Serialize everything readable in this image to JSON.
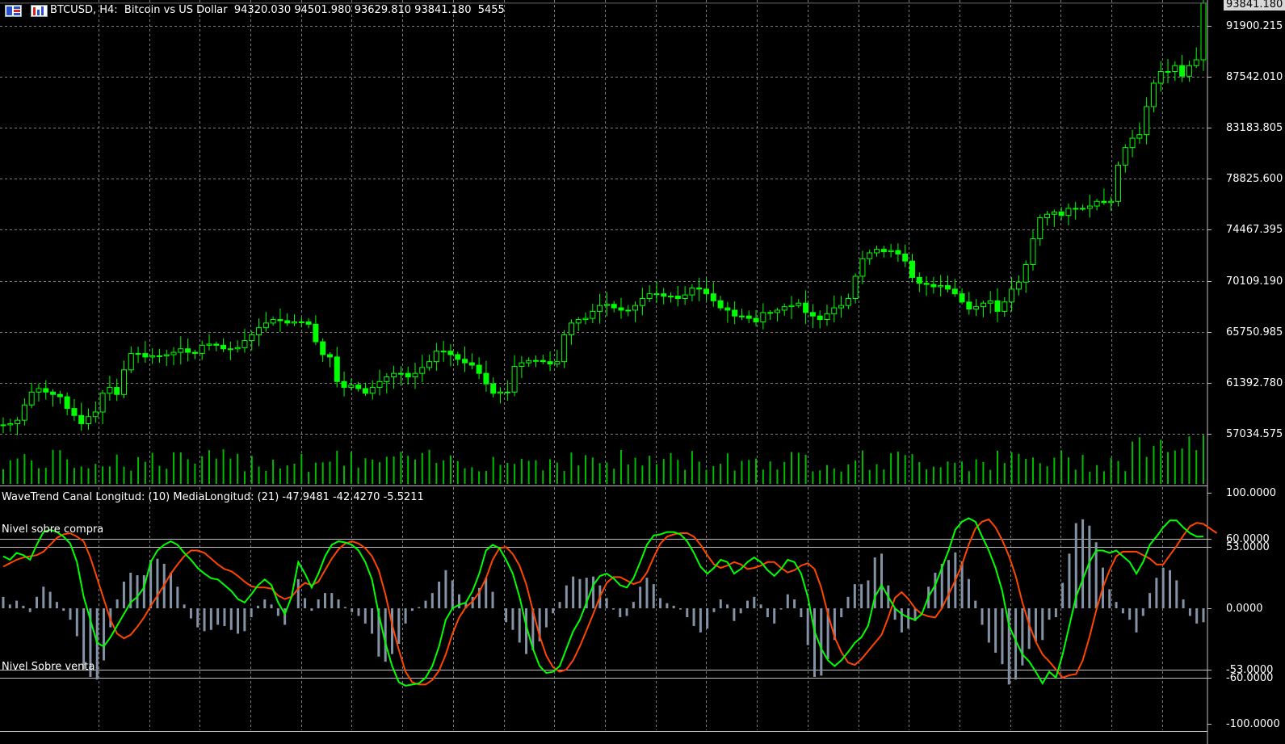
{
  "header": {
    "symbol_info": "BTCUSD, H4:  Bitcoin vs US Dollar  94320.030 94501.980 93629.810 93841.180  5455"
  },
  "icons": {
    "menu": "menu-icon",
    "chart_type": "bar-chart-icon"
  },
  "price_axis": {
    "current_price": "93841.180",
    "ticks": [
      "91900.215",
      "87542.010",
      "83183.805",
      "78825.600",
      "74467.395",
      "70109.190",
      "65750.985",
      "61392.780",
      "57034.575"
    ]
  },
  "indicator": {
    "title": "WaveTrend Canal Longitud: (10) MediaLongitud: (21) -47.9481 -42.4270 -5.5211",
    "overbought_label": "Nivel sobre compra",
    "oversold_label": "Nivel Sobre venta",
    "axis_ticks": [
      "100.0000",
      "60.0000",
      "53.0000",
      "0.0000",
      "-53.0000",
      "-60.0000",
      "-100.0000"
    ],
    "levels": [
      60,
      53,
      -53,
      -60
    ]
  },
  "colors": {
    "background": "#000000",
    "grid": "#7c7c7c",
    "candles": "#00ff00",
    "volume": "#00bb00",
    "wt1": "#00ff00",
    "wt2": "#ff4500",
    "histogram": "#8492a6",
    "levels": "#c0c0c0"
  },
  "chart_data": [
    {
      "type": "candlestick",
      "series": [
        {
          "name": "BTCUSD",
          "values": [
            57800,
            57900,
            58200,
            59500,
            60600,
            60900,
            60600,
            60400,
            60200,
            59200,
            58600,
            57900,
            58500,
            58900,
            60500,
            61000,
            60400,
            62500,
            63900,
            63900,
            63600,
            63700,
            63700,
            63800,
            64000,
            64300,
            64000,
            63900,
            64600,
            64700,
            64600,
            64300,
            64300,
            64400,
            65000,
            65500,
            66100,
            66500,
            66800,
            66700,
            66500,
            66600,
            66600,
            66400,
            64900,
            63800,
            63600,
            61500,
            61000,
            61200,
            60900,
            60500,
            61000,
            61500,
            61900,
            62200,
            62200,
            61900,
            62200,
            62700,
            63200,
            64100,
            64100,
            63800,
            63400,
            63100,
            62900,
            62200,
            61300,
            60500,
            60600,
            60600,
            62800,
            63100,
            63300,
            63300,
            63200,
            63000,
            63200,
            65500,
            66500,
            66800,
            66900,
            67500,
            68000,
            68100,
            67800,
            67600,
            67600,
            68000,
            68600,
            69000,
            69000,
            68800,
            68800,
            68600,
            68900,
            69500,
            69400,
            69000,
            68400,
            67800,
            67600,
            67100,
            67100,
            66900,
            66600,
            67400,
            67400,
            67600,
            67900,
            68000,
            68200,
            67400,
            67100,
            66800,
            67300,
            67800,
            68000,
            68600,
            70500,
            72000,
            72500,
            72800,
            72600,
            72700,
            72400,
            71800,
            70400,
            69900,
            69800,
            69600,
            69700,
            69400,
            69000,
            68300,
            67700,
            67900,
            68200,
            68400,
            67500,
            68300,
            69400,
            70000,
            71500,
            73700,
            75500,
            75800,
            76000,
            75700,
            76300,
            76300,
            76300,
            76500,
            76900,
            76800,
            76900,
            80000,
            81500,
            82300,
            82600,
            85000,
            87000,
            88000,
            88000,
            88500,
            87600,
            88500,
            89000,
            93841
          ]
        }
      ],
      "volume_note": "volume histogram shown beneath candles"
    },
    {
      "type": "line",
      "title": "WaveTrend Canal Longitud: (10) MediaLongitud: (21) -47.9481 -42.4270 -5.5211",
      "ylim": [
        -100,
        100
      ],
      "series": [
        {
          "name": "wt1",
          "values": [
            45,
            42,
            48,
            46,
            42,
            55,
            66,
            68,
            66,
            62,
            56,
            40,
            10,
            -10,
            -30,
            -33,
            -25,
            -15,
            -5,
            5,
            10,
            18,
            40,
            50,
            55,
            58,
            55,
            48,
            42,
            35,
            30,
            26,
            25,
            20,
            15,
            8,
            5,
            12,
            20,
            25,
            20,
            5,
            -5,
            10,
            40,
            30,
            18,
            30,
            45,
            55,
            58,
            57,
            55,
            50,
            40,
            25,
            -5,
            -30,
            -50,
            -64,
            -67,
            -66,
            -65,
            -60,
            -50,
            -33,
            -10,
            0,
            3,
            5,
            15,
            30,
            50,
            55,
            52,
            42,
            30,
            10,
            -15,
            -35,
            -50,
            -56,
            -55,
            -50,
            -35,
            -20,
            -10,
            5,
            20,
            28,
            30,
            26,
            20,
            18,
            26,
            40,
            55,
            63,
            64,
            66,
            66,
            64,
            58,
            48,
            36,
            30,
            35,
            42,
            40,
            30,
            34,
            40,
            44,
            40,
            33,
            28,
            34,
            42,
            40,
            30,
            10,
            -20,
            -35,
            -45,
            -50,
            -45,
            -38,
            -30,
            -25,
            -15,
            10,
            20,
            10,
            0,
            -5,
            -8,
            -10,
            -5,
            10,
            20,
            35,
            50,
            68,
            75,
            78,
            75,
            62,
            50,
            35,
            15,
            -15,
            -28,
            -40,
            -46,
            -55,
            -65,
            -55,
            -60,
            -40,
            -15,
            10,
            25,
            40,
            50,
            50,
            48,
            50,
            45,
            40,
            30,
            40,
            55,
            62,
            70,
            76,
            76,
            70,
            65,
            62,
            62
          ]
        },
        {
          "name": "wt2",
          "values": [
            36,
            39,
            42,
            44,
            45,
            46,
            49,
            55,
            61,
            64,
            65,
            62,
            58,
            44,
            26,
            8,
            -10,
            -22,
            -26,
            -23,
            -16,
            -8,
            2,
            11,
            20,
            30,
            38,
            45,
            50,
            50,
            48,
            43,
            38,
            34,
            32,
            28,
            23,
            19,
            18,
            18,
            17,
            11,
            8,
            10,
            17,
            22,
            20,
            23,
            33,
            43,
            51,
            56,
            58,
            56,
            52,
            45,
            33,
            12,
            -14,
            -36,
            -55,
            -64,
            -66,
            -66,
            -62,
            -54,
            -40,
            -22,
            -8,
            1,
            6,
            14,
            26,
            42,
            52,
            53,
            47,
            37,
            21,
            -2,
            -24,
            -41,
            -51,
            -55,
            -53,
            -45,
            -33,
            -19,
            -5,
            10,
            22,
            27,
            27,
            24,
            21,
            23,
            31,
            44,
            56,
            62,
            64,
            65,
            65,
            62,
            55,
            46,
            38,
            35,
            37,
            40,
            38,
            34,
            35,
            37,
            40,
            40,
            35,
            31,
            33,
            37,
            39,
            34,
            18,
            -5,
            -25,
            -38,
            -47,
            -49,
            -44,
            -37,
            -30,
            -23,
            -8,
            9,
            14,
            8,
            0,
            -5,
            -7,
            -8,
            0,
            12,
            24,
            38,
            55,
            69,
            75,
            77,
            70,
            59,
            45,
            28,
            5,
            -14,
            -29,
            -40,
            -46,
            -53,
            -60,
            -58,
            -57,
            -45,
            -25,
            -2,
            18,
            33,
            45,
            49,
            49,
            49,
            46,
            43,
            38,
            38,
            46,
            54,
            63,
            71,
            74,
            73,
            69,
            65
          ]
        }
      ]
    }
  ]
}
